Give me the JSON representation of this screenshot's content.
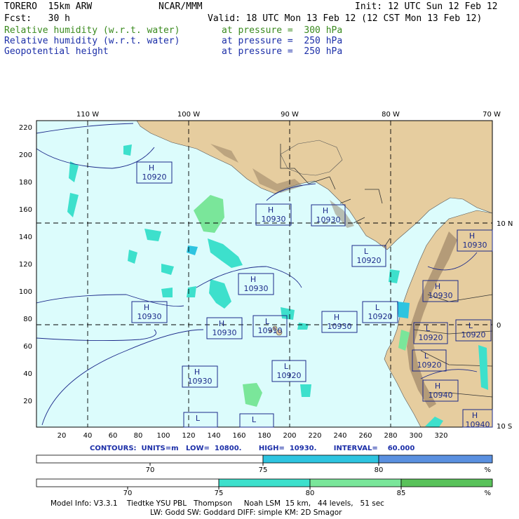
{
  "header": {
    "model": "TORERO  15km ARW",
    "org": "NCAR/MMM",
    "init": "Init: 12 UTC Sun 12 Feb 12",
    "fcst": "Fcst:   30 h",
    "valid": "Valid: 18 UTC Mon 13 Feb 12 (12 CST Mon 13 Feb 12)",
    "fields": [
      {
        "name": "Relative humidity (w.r.t. water)",
        "level": "at pressure =  300 hPa",
        "color": "#3a8a1e"
      },
      {
        "name": "Relative humidity (w.r.t. water)",
        "level": "at pressure =  250 hPa",
        "color": "#1c2fa8"
      },
      {
        "name": "Geopotential height",
        "level": "at pressure =  250 hPa",
        "color": "#1c2fa8"
      }
    ]
  },
  "map": {
    "top_lon_labels": [
      "110 W",
      "100 W",
      "90 W",
      "80 W",
      "70 W"
    ],
    "right_lat_labels": [
      "10 N",
      "0",
      "10 S"
    ],
    "y_ticks": [
      "220",
      "200",
      "180",
      "160",
      "140",
      "120",
      "100",
      "80",
      "60",
      "40",
      "20"
    ],
    "x_ticks": [
      "20",
      "40",
      "60",
      "80",
      "100",
      "120",
      "140",
      "160",
      "180",
      "200",
      "220",
      "240",
      "260",
      "280",
      "300",
      "320"
    ],
    "pressure_systems": [
      {
        "type": "H",
        "value": "10920"
      },
      {
        "type": "H",
        "value": "10930"
      },
      {
        "type": "H",
        "value": "10930"
      },
      {
        "type": "H",
        "value": "10930"
      },
      {
        "type": "L",
        "value": "10920"
      },
      {
        "type": "H",
        "value": "10930"
      },
      {
        "type": "H",
        "value": "10930"
      },
      {
        "type": "L",
        "value": "10910"
      },
      {
        "type": "H",
        "value": "10930"
      },
      {
        "type": "H",
        "value": "10930"
      },
      {
        "type": "H",
        "value": "10930"
      },
      {
        "type": "L",
        "value": "10920"
      },
      {
        "type": "L",
        "value": "10920"
      },
      {
        "type": "L",
        "value": "10920"
      },
      {
        "type": "L",
        "value": "10920"
      },
      {
        "type": "L",
        "value": "10920"
      },
      {
        "type": "H",
        "value": "10930"
      },
      {
        "type": "H",
        "value": "10940"
      },
      {
        "type": "L",
        "value": ""
      },
      {
        "type": "L",
        "value": ""
      },
      {
        "type": "H",
        "value": "10940"
      }
    ]
  },
  "contours": "CONTOURS:  UNITS=m   LOW=  10800.       HIGH=  10930.       INTERVAL=    60.000",
  "colorbar_rh250": {
    "labels": [
      "70",
      "75",
      "80"
    ],
    "unit": "%",
    "colors": [
      "#ffffff",
      "#2ec4e0",
      "#5a90e0"
    ]
  },
  "colorbar_rh300": {
    "labels": [
      "70",
      "75",
      "80",
      "85"
    ],
    "unit": "%",
    "colors": [
      "#ffffff",
      "#3de0cc",
      "#7ae69a",
      "#59c25a"
    ]
  },
  "footer": {
    "line1": "Model Info: V3.3.1    Tiedtke YSU PBL   Thompson     Noah LSM  15 km,   44 levels,   51 sec",
    "line2": "LW: Godd SW: Goddard DIFF: simple KM: 2D Smagor"
  }
}
